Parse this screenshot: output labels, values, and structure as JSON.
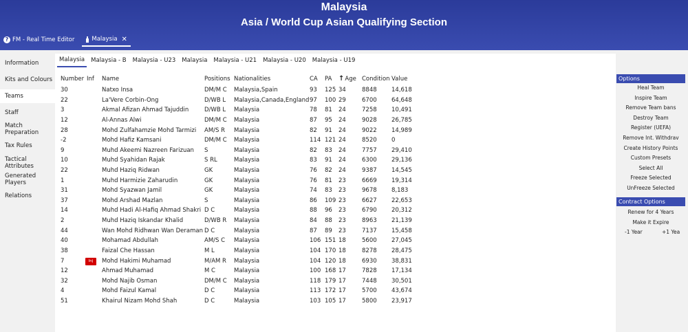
{
  "header": {
    "title": "Malaysia",
    "subtitle": "Asia / World Cup Asian Qualifying Section"
  },
  "tabs": [
    {
      "label": "FM - Real Time Editor",
      "icon": "question-icon"
    },
    {
      "label": "Malaysia",
      "icon": "shirt-icon",
      "close": "✕"
    }
  ],
  "sidebar": {
    "items": [
      {
        "label": "Information"
      },
      {
        "label": "Kits and Colours"
      },
      {
        "label": "Teams"
      },
      {
        "label": "Staff"
      },
      {
        "label": "Match Preparation"
      },
      {
        "label": "Tax Rules"
      },
      {
        "label": "Tactical Attributes"
      },
      {
        "label": "Generated Players"
      },
      {
        "label": "Relations"
      }
    ],
    "active": "Teams"
  },
  "subtabs": [
    "Malaysia",
    "Malaysia - B",
    "Malaysia - U23",
    "Malaysia",
    "Malaysia - U21",
    "Malaysia - U20",
    "Malaysia - U19"
  ],
  "table": {
    "columns": [
      "Number",
      "Inf",
      "Name",
      "Positions",
      "Nationalities",
      "CA",
      "PA",
      "Age",
      "Condition",
      "Value"
    ],
    "sort_icon": "arrow-up-icon",
    "rows": [
      {
        "number": "30",
        "inf": "",
        "name": "Natxo Insa",
        "positions": "DM/M C",
        "nationalities": "Malaysia,Spain",
        "ca": "93",
        "pa": "125",
        "age": "34",
        "condition": "8848",
        "value": "14,618"
      },
      {
        "number": "22",
        "inf": "",
        "name": "La'Vere Corbin-Ong",
        "positions": "D/WB L",
        "nationalities": "Malaysia,Canada,England",
        "ca": "97",
        "pa": "100",
        "age": "29",
        "condition": "6700",
        "value": "64,648"
      },
      {
        "number": "3",
        "inf": "",
        "name": "Akmal Afizan Ahmad Tajuddin",
        "positions": "D/WB L",
        "nationalities": "Malaysia",
        "ca": "78",
        "pa": "81",
        "age": "24",
        "condition": "7258",
        "value": "10,491"
      },
      {
        "number": "12",
        "inf": "",
        "name": "Al-Annas Alwi",
        "positions": "DM/M C",
        "nationalities": "Malaysia",
        "ca": "87",
        "pa": "95",
        "age": "24",
        "condition": "9028",
        "value": "26,785"
      },
      {
        "number": "28",
        "inf": "",
        "name": "Mohd Zulfahamzie Mohd Tarmizi",
        "positions": "AM/S R",
        "nationalities": "Malaysia",
        "ca": "82",
        "pa": "91",
        "age": "24",
        "condition": "9022",
        "value": "14,989"
      },
      {
        "number": "-2",
        "inf": "",
        "name": "Mohd Hafiz Kamsani",
        "positions": "DM/M C",
        "nationalities": "Malaysia",
        "ca": "114",
        "pa": "121",
        "age": "24",
        "condition": "8520",
        "value": "0"
      },
      {
        "number": "9",
        "inf": "",
        "name": "Muhd Akeemi Nazreen Farizuan",
        "positions": "S",
        "nationalities": "Malaysia",
        "ca": "82",
        "pa": "83",
        "age": "24",
        "condition": "7757",
        "value": "29,410"
      },
      {
        "number": "10",
        "inf": "",
        "name": "Muhd Syahidan Rajak",
        "positions": "S RL",
        "nationalities": "Malaysia",
        "ca": "83",
        "pa": "91",
        "age": "24",
        "condition": "6300",
        "value": "29,136"
      },
      {
        "number": "22",
        "inf": "",
        "name": "Muhd Haziq Ridwan",
        "positions": "GK",
        "nationalities": "Malaysia",
        "ca": "76",
        "pa": "82",
        "age": "24",
        "condition": "9387",
        "value": "14,545"
      },
      {
        "number": "1",
        "inf": "",
        "name": "Muhd Harmizie Zaharudin",
        "positions": "GK",
        "nationalities": "Malaysia",
        "ca": "76",
        "pa": "81",
        "age": "23",
        "condition": "6669",
        "value": "19,314"
      },
      {
        "number": "31",
        "inf": "",
        "name": "Mohd Syazwan Jamil",
        "positions": "GK",
        "nationalities": "Malaysia",
        "ca": "74",
        "pa": "83",
        "age": "23",
        "condition": "9678",
        "value": "8,183"
      },
      {
        "number": "37",
        "inf": "",
        "name": "Mohd Arshad Mazlan",
        "positions": "S",
        "nationalities": "Malaysia",
        "ca": "86",
        "pa": "109",
        "age": "23",
        "condition": "6627",
        "value": "22,653"
      },
      {
        "number": "14",
        "inf": "",
        "name": "Muhd Hadi Al-Hafiq Ahmad Shakri",
        "positions": "D C",
        "nationalities": "Malaysia",
        "ca": "88",
        "pa": "96",
        "age": "23",
        "condition": "6790",
        "value": "20,312"
      },
      {
        "number": "2",
        "inf": "",
        "name": "Muhd Haziq Iskandar Khalid",
        "positions": "D/WB R",
        "nationalities": "Malaysia",
        "ca": "84",
        "pa": "88",
        "age": "23",
        "condition": "8963",
        "value": "21,139"
      },
      {
        "number": "44",
        "inf": "",
        "name": "Wan Mohd Ridhwan Wan Deraman",
        "positions": "D C",
        "nationalities": "Malaysia",
        "ca": "87",
        "pa": "89",
        "age": "23",
        "condition": "7137",
        "value": "15,458"
      },
      {
        "number": "40",
        "inf": "",
        "name": "Mohamad Abdullah",
        "positions": "AM/S C",
        "nationalities": "Malaysia",
        "ca": "106",
        "pa": "151",
        "age": "18",
        "condition": "5600",
        "value": "27,045"
      },
      {
        "number": "38",
        "inf": "",
        "name": "Faizal Che Hassan",
        "positions": "M L",
        "nationalities": "Malaysia",
        "ca": "104",
        "pa": "170",
        "age": "18",
        "condition": "8278",
        "value": "28,475"
      },
      {
        "number": "7",
        "inf": "Inj",
        "name": "Mohd Hakimi Muhamad",
        "positions": "M/AM R",
        "nationalities": "Malaysia",
        "ca": "104",
        "pa": "120",
        "age": "18",
        "condition": "6930",
        "value": "38,831"
      },
      {
        "number": "12",
        "inf": "",
        "name": "Ahmad Muhamad",
        "positions": "M C",
        "nationalities": "Malaysia",
        "ca": "100",
        "pa": "168",
        "age": "17",
        "condition": "7828",
        "value": "17,134"
      },
      {
        "number": "32",
        "inf": "",
        "name": "Mohd Najib Osman",
        "positions": "DM/M C",
        "nationalities": "Malaysia",
        "ca": "118",
        "pa": "179",
        "age": "17",
        "condition": "7448",
        "value": "30,501"
      },
      {
        "number": "4",
        "inf": "",
        "name": "Mohd Faizul Kamal",
        "positions": "D C",
        "nationalities": "Malaysia",
        "ca": "113",
        "pa": "172",
        "age": "17",
        "condition": "5700",
        "value": "43,674"
      },
      {
        "number": "51",
        "inf": "",
        "name": "Khairul Nizam Mohd Shah",
        "positions": "D C",
        "nationalities": "Malaysia",
        "ca": "103",
        "pa": "105",
        "age": "17",
        "condition": "5800",
        "value": "23,917"
      }
    ]
  },
  "options": {
    "title": "Options",
    "items": [
      "Heal Team",
      "Inspire Team",
      "Remove Team bans",
      "Destroy Team",
      "Register (UEFA)",
      "Remove Int. Withdrav",
      "Create History Points",
      "Custom Presets",
      "Select All",
      "Freeze Selected",
      "UnFreeze Selected"
    ]
  },
  "contract_options": {
    "title": "Contract Options",
    "items": [
      "Renew for 4 Years",
      "Make it Expire"
    ],
    "minus": "-1 Year",
    "plus": "+1 Yea"
  },
  "colors": {
    "header": "#2b3b9a",
    "accent": "#3a4cb0",
    "injury": "#d20000"
  }
}
